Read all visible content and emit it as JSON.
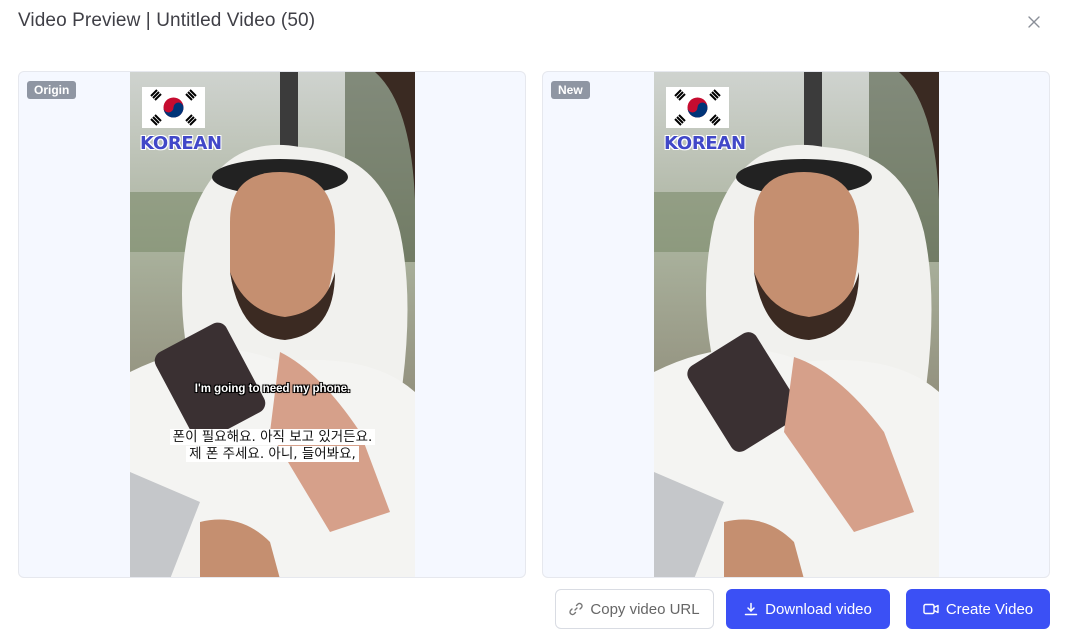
{
  "dialog": {
    "title": "Video Preview | Untitled Video (50)"
  },
  "panels": {
    "origin": {
      "tag": "Origin",
      "overlay_text": "KOREAN",
      "subtitle_en": "I'm going to need my phone.",
      "subtitle_ko_line1": "폰이 필요해요. 아직 보고 있거든요.",
      "subtitle_ko_line2": "제 폰 주세요. 아니, 들어봐요,"
    },
    "new": {
      "tag": "New",
      "overlay_text": "KOREAN"
    }
  },
  "actions": {
    "copy_url_label": "Copy video URL",
    "download_label": "Download video",
    "create_label": "Create Video"
  },
  "icons": {
    "close": "close-icon",
    "link": "link-icon",
    "download": "download-icon",
    "video": "video-camera-icon",
    "flag": "south-korea-flag-icon"
  },
  "colors": {
    "primary": "#3b50f5",
    "tag_bg": "#8f96a3",
    "panel_bg": "#f5f8ff",
    "korean_text": "#4148c8"
  }
}
